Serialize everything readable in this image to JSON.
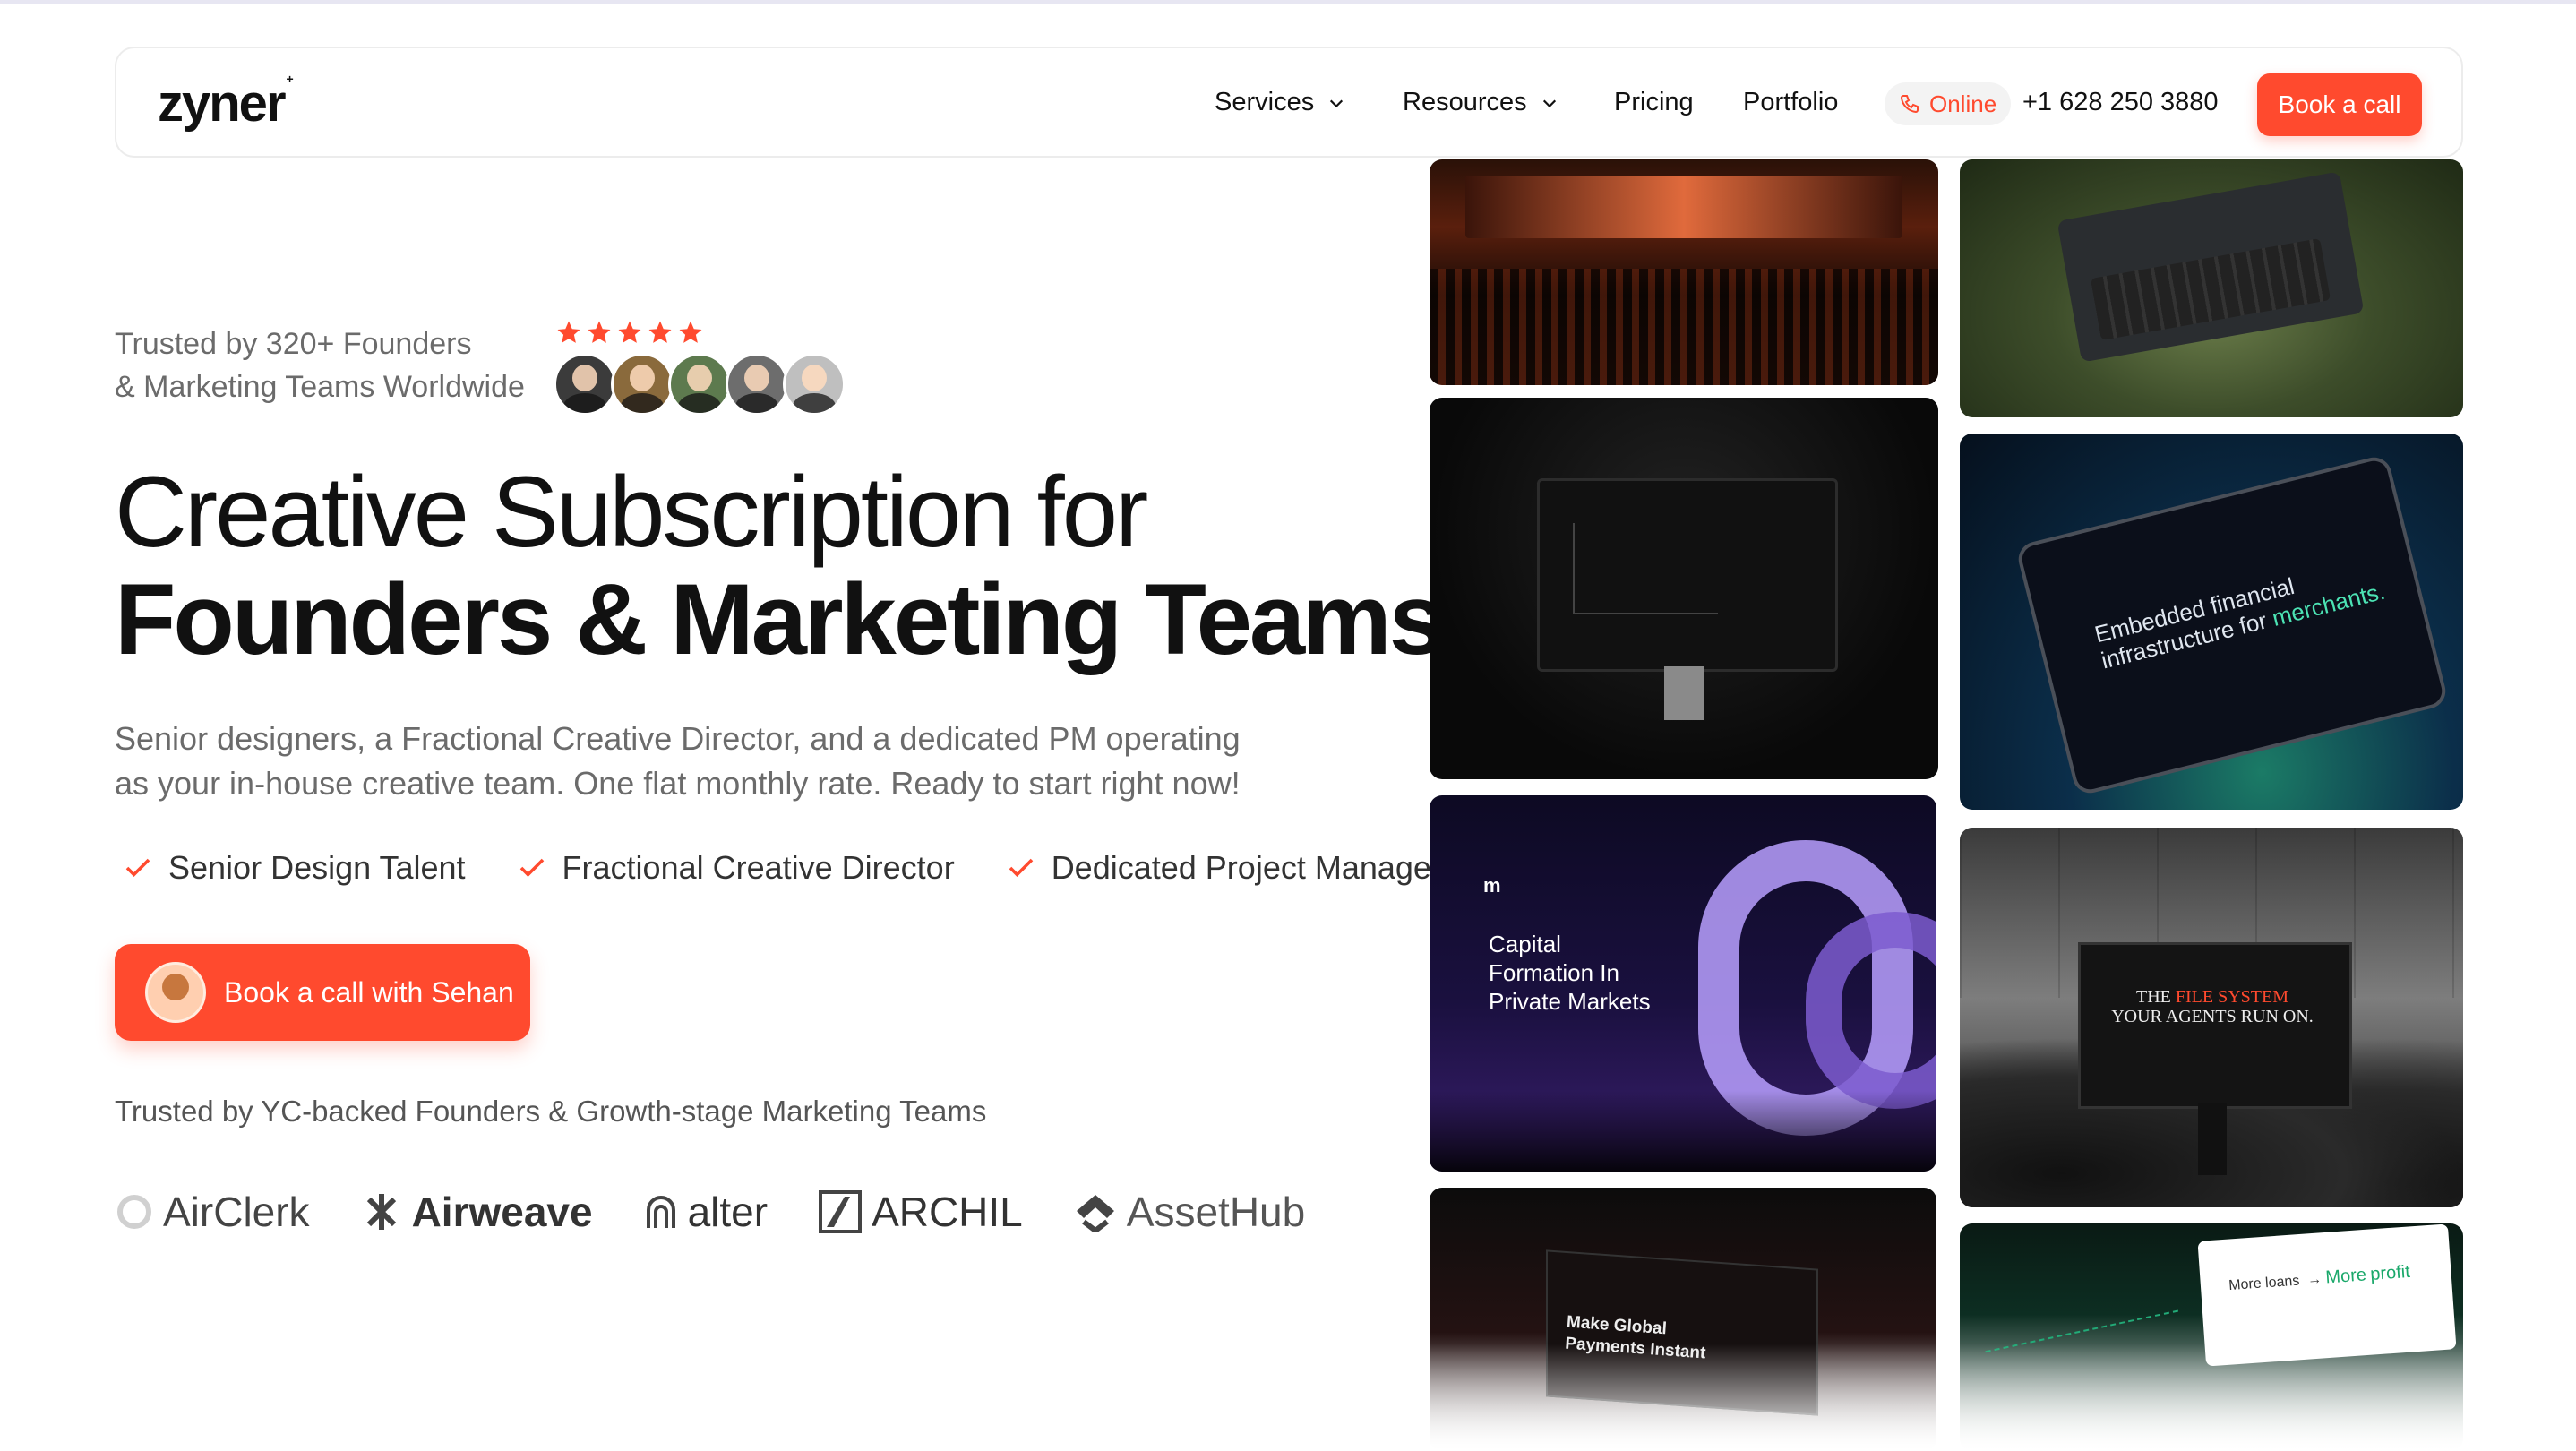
{
  "nav": {
    "logo": "zyner",
    "logo_mark": "+",
    "items": [
      {
        "label": "Services",
        "has_dropdown": true
      },
      {
        "label": "Resources",
        "has_dropdown": true
      },
      {
        "label": "Pricing",
        "has_dropdown": false
      },
      {
        "label": "Portfolio",
        "has_dropdown": false
      }
    ],
    "status": "Online",
    "phone": "+1 628 250 3880",
    "cta": "Book a call"
  },
  "hero": {
    "trusted_line1": "Trusted by 320+ Founders",
    "trusted_line2": "& Marketing Teams Worldwide",
    "rating_stars": 5,
    "headline_line1": "Creative Subscription for",
    "headline_line2": "Founders & Marketing Teams",
    "subheadline": "Senior designers, a Fractional Creative Director, and a dedicated PM operating as your in-house creative team. One flat monthly rate. Ready to start right now!",
    "features": [
      "Senior Design Talent",
      "Fractional Creative Director",
      "Dedicated Project Manager"
    ],
    "cta": "Book a call with Sehan",
    "trusted_by": "Trusted by YC-backed Founders & Growth-stage Marketing Teams",
    "brands": [
      "AirClerk",
      "Airweave",
      "alter",
      "ARCHIL",
      "AssetHub"
    ]
  },
  "gallery": {
    "tile3_logo": "m",
    "tile3_text": [
      "Capital",
      "Formation In",
      "Private Markets"
    ],
    "tile4_text": [
      "Make Global",
      "Payments Instant"
    ],
    "tile6_line1": "Embedded financial",
    "tile6_line2_prefix": "infrastructure for ",
    "tile6_line2_accent": "merchants.",
    "tile7_line1_prefix": "THE ",
    "tile7_line1_accent": "FILE SYSTEM",
    "tile7_line2": "YOUR AGENTS RUN ON.",
    "tile8_left": "More loans",
    "tile8_right_prefix": "More",
    "tile8_right_accent": "profit"
  },
  "colors": {
    "accent": "#ff4a2e",
    "text": "#111111",
    "muted": "#6b6b6b"
  }
}
